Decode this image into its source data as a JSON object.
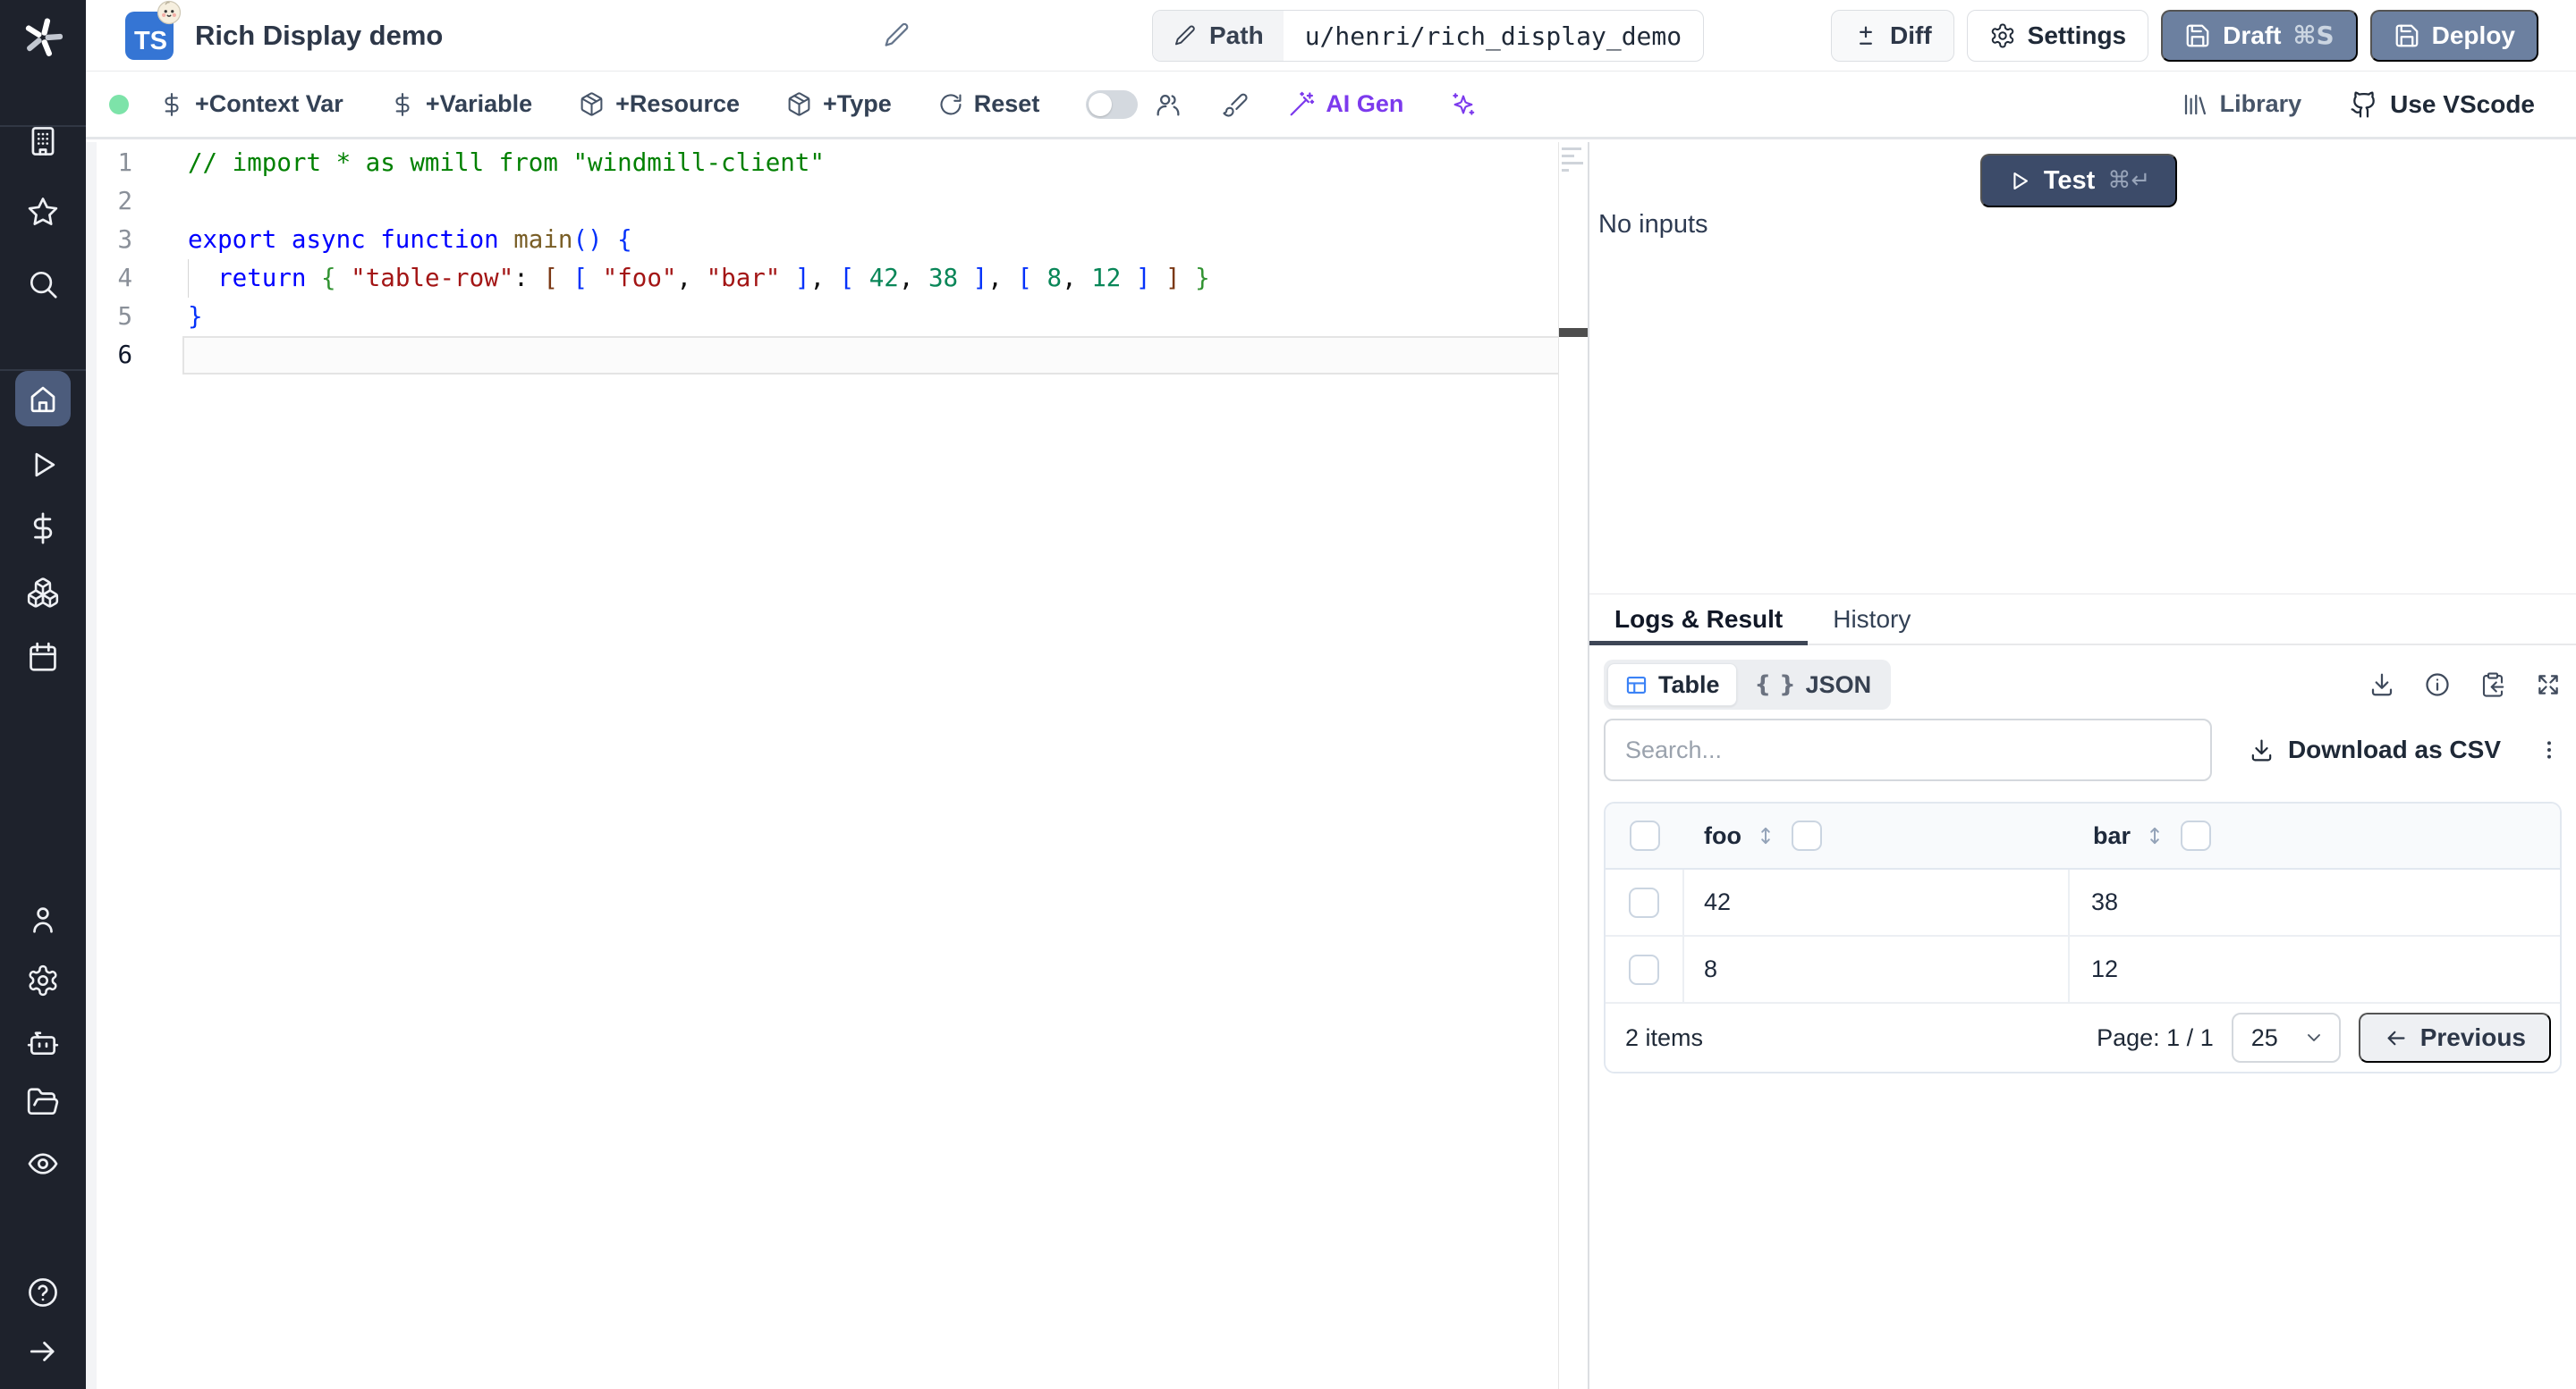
{
  "header": {
    "badge": "TS",
    "title": "Rich Display demo",
    "path_label": "Path",
    "path_value": "u/henri/rich_display_demo",
    "diff_label": "Diff",
    "settings_label": "Settings",
    "draft_label": "Draft",
    "draft_shortcut": "⌘S",
    "deploy_label": "Deploy"
  },
  "toolbar": {
    "context_var_label": "+Context Var",
    "variable_label": "+Variable",
    "resource_label": "+Resource",
    "type_label": "+Type",
    "reset_label": "Reset",
    "ai_gen_label": "AI Gen",
    "library_label": "Library",
    "vscode_label": "Use VScode"
  },
  "editor": {
    "lines": [
      {
        "num": "1",
        "segments": [
          {
            "t": "// import * as wmill from \"windmill-client\"",
            "c": "tok-comment"
          }
        ]
      },
      {
        "num": "2",
        "segments": []
      },
      {
        "num": "3",
        "segments": [
          {
            "t": "export async function ",
            "c": "tok-kw"
          },
          {
            "t": "main",
            "c": "tok-fn"
          },
          {
            "t": "() {",
            "c": "tok-b1"
          }
        ]
      },
      {
        "num": "4",
        "guide": true,
        "segments": [
          {
            "t": "  ",
            "c": "tok-plain"
          },
          {
            "t": "return ",
            "c": "tok-kw"
          },
          {
            "t": "{ ",
            "c": "tok-b2"
          },
          {
            "t": "\"table-row\"",
            "c": "tok-str"
          },
          {
            "t": ": ",
            "c": "tok-plain"
          },
          {
            "t": "[ ",
            "c": "tok-b3"
          },
          {
            "t": "[ ",
            "c": "tok-b1"
          },
          {
            "t": "\"foo\"",
            "c": "tok-str"
          },
          {
            "t": ", ",
            "c": "tok-plain"
          },
          {
            "t": "\"bar\"",
            "c": "tok-str"
          },
          {
            "t": " ]",
            "c": "tok-b1"
          },
          {
            "t": ", ",
            "c": "tok-plain"
          },
          {
            "t": "[ ",
            "c": "tok-b1"
          },
          {
            "t": "42",
            "c": "tok-num"
          },
          {
            "t": ", ",
            "c": "tok-plain"
          },
          {
            "t": "38",
            "c": "tok-num"
          },
          {
            "t": " ]",
            "c": "tok-b1"
          },
          {
            "t": ", ",
            "c": "tok-plain"
          },
          {
            "t": "[ ",
            "c": "tok-b1"
          },
          {
            "t": "8",
            "c": "tok-num"
          },
          {
            "t": ", ",
            "c": "tok-plain"
          },
          {
            "t": "12",
            "c": "tok-num"
          },
          {
            "t": " ]",
            "c": "tok-b1"
          },
          {
            "t": " ]",
            "c": "tok-b3"
          },
          {
            "t": " }",
            "c": "tok-b2"
          }
        ]
      },
      {
        "num": "5",
        "segments": [
          {
            "t": "}",
            "c": "tok-b1"
          }
        ]
      },
      {
        "num": "6",
        "active": true,
        "segments": []
      }
    ]
  },
  "run_panel": {
    "test_label": "Test",
    "test_shortcut": "⌘↵",
    "no_inputs": "No inputs"
  },
  "tabs": {
    "logs_result": "Logs & Result",
    "history": "History"
  },
  "result": {
    "table_view_label": "Table",
    "json_view_label": "JSON",
    "braces_glyph": "{ }",
    "search_placeholder": "Search...",
    "download_csv_label": "Download as CSV",
    "table": {
      "columns": [
        "foo",
        "bar"
      ],
      "rows": [
        [
          "42",
          "38"
        ],
        [
          "8",
          "12"
        ]
      ]
    },
    "footer": {
      "count": "2 items",
      "page": "Page: 1 / 1",
      "page_size": "25",
      "previous_label": "Previous"
    }
  },
  "icons": {
    "sidebar": [
      "windmill-logo",
      "building",
      "star",
      "search",
      "home",
      "play",
      "dollar",
      "boxes",
      "calendar",
      "user",
      "gear",
      "bot",
      "folder-open",
      "eye",
      "help-circle",
      "arrow-right"
    ],
    "header": [
      "pencil",
      "diff",
      "gear",
      "save"
    ],
    "toolbar": [
      "dollar",
      "package",
      "rotate-cw",
      "users",
      "brush",
      "wand-sparkles",
      "sparkles",
      "library",
      "github"
    ],
    "result": [
      "play",
      "table",
      "braces",
      "download",
      "info",
      "clipboard-copy",
      "maximize",
      "kebab",
      "sort-updown",
      "chevron-down",
      "arrow-left"
    ]
  },
  "colors": {
    "sidebar_bg": "#1e222c",
    "active_item_bg": "#4c5c7c",
    "ts_badge_blue": "#3575d4",
    "slate_button": "#6c80a0",
    "test_button": "#3c4b69",
    "ai_purple": "#7c3aed",
    "status_green": "#7de3a9",
    "table_icon_blue": "#3b82f6"
  }
}
